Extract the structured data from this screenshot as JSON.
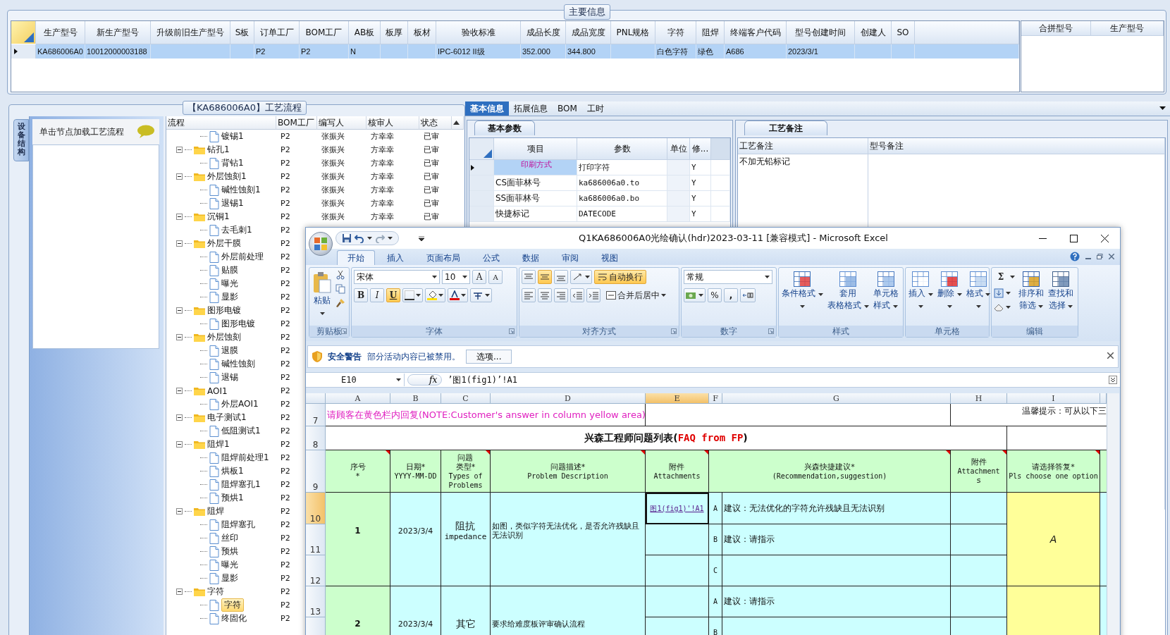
{
  "main_info": {
    "title": "主要信息",
    "columns": [
      "生产型号",
      "新生产型号",
      "升级前旧生产型号",
      "S板",
      "订单工厂",
      "BOM工厂",
      "AB板",
      "板厚",
      "板材",
      "验收标准",
      "成品长度",
      "成品宽度",
      "PNL规格",
      "字符",
      "阻焊",
      "终端客户代码",
      "型号创建时间",
      "创建人",
      "SO"
    ],
    "rows": [
      {
        "selected": true,
        "cells": [
          "KA686006A0",
          "10012000003188",
          null,
          null,
          "P2",
          "P2",
          "N",
          null,
          null,
          "IPC-6012 II级",
          "352.000",
          "344.800",
          null,
          "白色字符",
          "绿色",
          "A686",
          "2023/3/1",
          null,
          null
        ]
      }
    ]
  },
  "merge_panel": {
    "columns": [
      "合拼型号",
      "生产型号"
    ]
  },
  "process_panel": {
    "title": "【KA686006A0】工艺流程",
    "side_tab": "设备结构",
    "hint": "单击节点加载工艺流程",
    "columns": [
      "流程",
      "BOM工厂",
      "编写人",
      "核审人",
      "状态"
    ],
    "tree": [
      {
        "children": [
          {
            "label": "镀锡1",
            "kind": "file",
            "bom": "P2",
            "author": "张振兴",
            "reviewer": "方幸幸",
            "status": "已审",
            "selected": false
          }
        ]
      },
      {
        "label": "钻孔1",
        "kind": "folder",
        "expanded": true,
        "bom": "P2",
        "author": "张振兴",
        "reviewer": "方幸幸",
        "status": "已审",
        "selected": false,
        "children": [
          {
            "label": "背钻1",
            "kind": "file",
            "bom": "P2",
            "author": "张振兴",
            "reviewer": "方幸幸",
            "status": "已审",
            "selected": false
          }
        ]
      },
      {
        "label": "外层蚀刻1",
        "kind": "folder",
        "expanded": true,
        "bom": "P2",
        "author": "张振兴",
        "reviewer": "方幸幸",
        "status": "已审",
        "selected": false,
        "children": [
          {
            "label": "碱性蚀刻1",
            "kind": "file",
            "bom": "P2",
            "author": "张振兴",
            "reviewer": "方幸幸",
            "status": "已审",
            "selected": false
          },
          {
            "label": "退锡1",
            "kind": "file",
            "bom": "P2",
            "author": "张振兴",
            "reviewer": "方幸幸",
            "status": "已审",
            "selected": false
          }
        ]
      },
      {
        "label": "沉铜1",
        "kind": "folder",
        "expanded": true,
        "bom": "P2",
        "author": "张振兴",
        "reviewer": "方幸幸",
        "status": "已审",
        "selected": false,
        "children": [
          {
            "label": "去毛刺1",
            "kind": "file",
            "bom": "P2",
            "selected": false
          }
        ]
      },
      {
        "label": "外层干膜",
        "kind": "folder",
        "expanded": true,
        "bom": "P2",
        "selected": false,
        "children": [
          {
            "label": "外层前处理",
            "kind": "file",
            "bom": "P2",
            "selected": false
          },
          {
            "label": "贴膜",
            "kind": "file",
            "bom": "P2",
            "selected": false
          },
          {
            "label": "曝光",
            "kind": "file",
            "bom": "P2",
            "selected": false
          },
          {
            "label": "显影",
            "kind": "file",
            "bom": "P2",
            "selected": false
          }
        ]
      },
      {
        "label": "图形电镀",
        "kind": "folder",
        "expanded": true,
        "bom": "P2",
        "selected": false,
        "children": [
          {
            "label": "图形电镀",
            "kind": "file",
            "bom": "P2",
            "selected": false
          }
        ]
      },
      {
        "label": "外层蚀刻",
        "kind": "folder",
        "expanded": true,
        "bom": "P2",
        "selected": false,
        "children": [
          {
            "label": "退膜",
            "kind": "file",
            "bom": "P2",
            "selected": false
          },
          {
            "label": "碱性蚀刻",
            "kind": "file",
            "bom": "P2",
            "selected": false
          },
          {
            "label": "退锡",
            "kind": "file",
            "bom": "P2",
            "selected": false
          }
        ]
      },
      {
        "label": "AOI1",
        "kind": "folder",
        "expanded": true,
        "bom": "P2",
        "selected": false,
        "children": [
          {
            "label": "外层AOI1",
            "kind": "file",
            "bom": "P2",
            "selected": false
          }
        ]
      },
      {
        "label": "电子测试1",
        "kind": "folder",
        "expanded": true,
        "bom": "P2",
        "selected": false,
        "children": [
          {
            "label": "低阻测试1",
            "kind": "file",
            "bom": "P2",
            "selected": false
          }
        ]
      },
      {
        "label": "阻焊1",
        "kind": "folder",
        "expanded": true,
        "bom": "P2",
        "selected": false,
        "children": [
          {
            "label": "阻焊前处理1",
            "kind": "file",
            "bom": "P2",
            "selected": false
          },
          {
            "label": "烘板1",
            "kind": "file",
            "bom": "P2",
            "selected": false
          },
          {
            "label": "阻焊塞孔1",
            "kind": "file",
            "bom": "P2",
            "selected": false
          },
          {
            "label": "预烘1",
            "kind": "file",
            "bom": "P2",
            "selected": false
          }
        ]
      },
      {
        "label": "阻焊",
        "kind": "folder",
        "expanded": true,
        "bom": "P2",
        "selected": false,
        "children": [
          {
            "label": "阻焊塞孔",
            "kind": "file",
            "bom": "P2",
            "selected": false
          },
          {
            "label": "丝印",
            "kind": "file",
            "bom": "P2",
            "selected": false
          },
          {
            "label": "预烘",
            "kind": "file",
            "bom": "P2",
            "selected": false
          },
          {
            "label": "曝光",
            "kind": "file",
            "bom": "P2",
            "selected": false
          },
          {
            "label": "显影",
            "kind": "file",
            "bom": "P2",
            "selected": false
          }
        ]
      },
      {
        "label": "字符",
        "kind": "folder",
        "expanded": true,
        "bom": "P2",
        "selected": false,
        "children": [
          {
            "label": "字符",
            "kind": "file",
            "bom": "P2",
            "selected": true
          },
          {
            "label": "终固化",
            "kind": "file",
            "bom": "P2",
            "selected": false
          }
        ]
      }
    ]
  },
  "detail_tabs": [
    {
      "label": "基本信息",
      "selected": true
    },
    {
      "label": "拓展信息",
      "selected": false
    },
    {
      "label": "BOM",
      "selected": false
    },
    {
      "label": "工时",
      "selected": false
    }
  ],
  "basic_params": {
    "tab": "基本参数",
    "columns": [
      "项目",
      "参数",
      "单位",
      "修..."
    ],
    "rows": [
      {
        "item": "印刷方式",
        "value": "打印字符",
        "flag": "Y",
        "selected": true
      },
      {
        "item": "CS面菲林号",
        "value": "ka686006a0.to",
        "flag": "Y",
        "selected": false
      },
      {
        "item": "SS面菲林号",
        "value": "ka686006a0.bo",
        "flag": "Y",
        "selected": false
      },
      {
        "item": "快捷标记",
        "value": "DATECODE",
        "flag": "Y",
        "selected": false
      }
    ]
  },
  "notes": {
    "tab": "工艺备注",
    "columns": [
      "工艺备注",
      "型号备注"
    ],
    "process_note": "不加无铅标记"
  },
  "excel": {
    "title": "Q1KA686006A0光绘确认(hdr)2023-03-11  [兼容模式] - Microsoft Excel",
    "tabs": [
      {
        "label": "开始",
        "selected": true
      },
      {
        "label": "插入",
        "selected": false
      },
      {
        "label": "页面布局",
        "selected": false
      },
      {
        "label": "公式",
        "selected": false
      },
      {
        "label": "数据",
        "selected": false
      },
      {
        "label": "审阅",
        "selected": false
      },
      {
        "label": "视图",
        "selected": false
      }
    ],
    "clipboard": {
      "label": "剪贴板",
      "paste": "粘贴"
    },
    "font": {
      "label": "字体",
      "name": "宋体",
      "size": "10",
      "grow": "A",
      "shrink": "A",
      "styles": [
        {
          "label": "B",
          "selected": false
        },
        {
          "label": "I",
          "selected": false
        },
        {
          "label": "U",
          "selected": true
        }
      ]
    },
    "alignment": {
      "label": "对齐方式",
      "wrap": "自动换行",
      "wrap_on": true,
      "merge": "合并后居中"
    },
    "number": {
      "label": "数字",
      "format": "常规",
      "percent": "%",
      "comma": ","
    },
    "styles": {
      "label": "样式",
      "buttons": [
        [
          "条件格式"
        ],
        [
          "套用",
          "表格格式"
        ],
        [
          "单元格",
          "样式"
        ]
      ]
    },
    "cells": {
      "label": "单元格",
      "buttons": [
        [
          "插入"
        ],
        [
          "删除"
        ],
        [
          "格式"
        ]
      ]
    },
    "editing": {
      "label": "编辑",
      "sum": "Σ",
      "buttons": [
        [
          "排序和",
          "筛选"
        ],
        [
          "查找和",
          "选择"
        ]
      ]
    },
    "security": {
      "title": "安全警告",
      "message": "部分活动内容已被禁用。",
      "button": "选项..."
    },
    "formula": {
      "name_box": "E10",
      "fx": "fx",
      "content": "’图1(fig1)’!A1"
    },
    "sheet": {
      "columns": [
        {
          "label": "A",
          "selected": false
        },
        {
          "label": "B",
          "selected": false
        },
        {
          "label": "C",
          "selected": false
        },
        {
          "label": "D",
          "selected": false
        },
        {
          "label": "E",
          "selected": true
        },
        {
          "label": "F",
          "selected": false
        },
        {
          "label": "G",
          "selected": false
        },
        {
          "label": "H",
          "selected": false
        },
        {
          "label": "I",
          "selected": false
        }
      ],
      "rows": [
        {
          "label": "7",
          "selected": false
        },
        {
          "label": "8",
          "selected": false
        },
        {
          "label": "9",
          "selected": false
        },
        {
          "label": "10",
          "selected": true
        },
        {
          "label": "11",
          "selected": false
        },
        {
          "label": "12",
          "selected": false
        },
        {
          "label": "13",
          "selected": false
        }
      ],
      "note": "请顾客在黄色栏内回复(NOTE:Customer's answer in column yellow area)",
      "tip": "温馨提示：可从以下三",
      "title": "兴森工程师问题列表(",
      "title_code": "FAQ from FP",
      "title_end": ")",
      "headers": [
        {
          "lines": [
            "序号",
            "*"
          ],
          "comment": true
        },
        {
          "lines": [
            "日期*",
            "YYYY-MM-DD"
          ],
          "comment": false
        },
        {
          "lines": [
            "问题",
            "类型*",
            "Types of",
            "Problems"
          ],
          "comment": true
        },
        {
          "lines": [
            "问题描述*",
            "Problem Description"
          ],
          "comment": true
        },
        {
          "lines": [
            "附件",
            "Attachments"
          ],
          "comment": true
        },
        {
          "lines": [
            "兴森快捷建议*",
            "(Recommendation,suggestion)"
          ],
          "comment": true
        },
        {
          "lines": [
            "附件",
            "Attachment",
            "s"
          ],
          "comment": true
        },
        {
          "lines": [
            "请选择答复*",
            "Pls choose one option"
          ],
          "comment": true
        }
      ],
      "records": [
        {
          "number": "1",
          "date": "2023/3/4",
          "type": [
            "阻抗",
            "impedance"
          ],
          "description": "如图，类似字符无法优化，是否允许残缺且无法识别",
          "answer": "A",
          "options": [
            {
              "letter": "A",
              "attachment": "图1(fig1)'!A1",
              "suggestion": "建议：无法优化的字符允许残缺且无法识别",
              "selected": true
            },
            {
              "letter": "B",
              "suggestion": "建议：请指示",
              "selected": false
            },
            {
              "letter": "C",
              "selected": false
            }
          ]
        },
        {
          "number": "2",
          "date": "2023/3/4",
          "type": [
            "其它"
          ],
          "description": "要求给难度板评审确认流程",
          "options": [
            {
              "letter": "A",
              "suggestion": "建议：请指示",
              "selected": false
            },
            {
              "letter": "B",
              "selected": false
            }
          ]
        }
      ]
    }
  }
}
